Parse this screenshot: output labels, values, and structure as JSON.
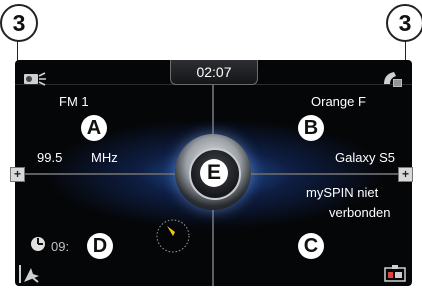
{
  "callouts": {
    "left": "3",
    "right": "3"
  },
  "header": {
    "time": "02:07"
  },
  "zones": {
    "a": {
      "badge": "A",
      "station": "FM 1",
      "frequency": "99.5",
      "unit": "MHz"
    },
    "b": {
      "badge": "B",
      "operator": "Orange F",
      "device": "Galaxy S5"
    },
    "c": {
      "badge": "C",
      "status_line1": "mySPIN niet",
      "status_line2": "verbonden"
    },
    "d": {
      "badge": "D",
      "clock_text": "09:"
    }
  },
  "center": {
    "badge": "E"
  },
  "controls": {
    "plus_left": "+",
    "plus_right": "+"
  },
  "icons": [
    "radio-icon",
    "phone-icon",
    "clock-icon",
    "compass-icon",
    "nav-icon",
    "phone-apps-icon"
  ],
  "colors": {
    "screen_bg": "#050608",
    "glow": "#306ed7",
    "divider": "#5b5e63"
  }
}
